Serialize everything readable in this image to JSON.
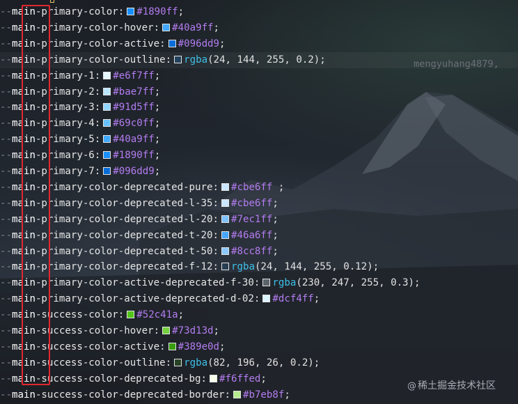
{
  "blame_annotation": "mengyuhang4879,",
  "watermark": {
    "icon": "copyright-icon",
    "icon_glyph": "@",
    "text": "稀土掘金技术社区"
  },
  "lines": [
    {
      "indent": "--",
      "word": "main",
      "name": "-primary-color:",
      "value_type": "hex",
      "value": "#1890ff",
      "swatch": "#1890ff",
      "end": ";"
    },
    {
      "indent": "--",
      "word": "main",
      "name": "-primary-color-hover:",
      "value_type": "hex",
      "value": "#40a9ff",
      "swatch": "#40a9ff",
      "end": ";"
    },
    {
      "indent": "--",
      "word": "main",
      "name": "-primary-color-active:",
      "value_type": "hex",
      "value": "#096dd9",
      "swatch": "#096dd9",
      "end": ";"
    },
    {
      "indent": "--",
      "word": "main",
      "name": "-primary-color-outline:",
      "value_type": "rgba",
      "fn": "rgba",
      "args": "(24, 144, 255, 0.2)",
      "swatch": "rgba(24,144,255,0.2)",
      "end": ";",
      "highlighted": true
    },
    {
      "indent": "--",
      "word": "main",
      "name": "-primary-1:",
      "value_type": "hex",
      "value": "#e6f7ff",
      "swatch": "#e6f7ff",
      "end": ";"
    },
    {
      "indent": "--",
      "word": "main",
      "name": "-primary-2:",
      "value_type": "hex",
      "value": "#bae7ff",
      "swatch": "#bae7ff",
      "end": ";"
    },
    {
      "indent": "--",
      "word": "main",
      "name": "-primary-3:",
      "value_type": "hex",
      "value": "#91d5ff",
      "swatch": "#91d5ff",
      "end": ";"
    },
    {
      "indent": "--",
      "word": "main",
      "name": "-primary-4:",
      "value_type": "hex",
      "value": "#69c0ff",
      "swatch": "#69c0ff",
      "end": ";"
    },
    {
      "indent": "--",
      "word": "main",
      "name": "-primary-5:",
      "value_type": "hex",
      "value": "#40a9ff",
      "swatch": "#40a9ff",
      "end": ";"
    },
    {
      "indent": "--",
      "word": "main",
      "name": "-primary-6:",
      "value_type": "hex",
      "value": "#1890ff",
      "swatch": "#1890ff",
      "end": ";"
    },
    {
      "indent": "--",
      "word": "main",
      "name": "-primary-7:",
      "value_type": "hex",
      "value": "#096dd9",
      "swatch": "#096dd9",
      "end": ";"
    },
    {
      "indent": "--",
      "word": "main",
      "name": "-primary-color-deprecated-pure:",
      "value_type": "hex",
      "value": "#cbe6ff",
      "swatch": "#cbe6ff",
      "end": " ;"
    },
    {
      "indent": "--",
      "word": "main",
      "name": "-primary-color-deprecated-l-35:",
      "value_type": "hex",
      "value": "#cbe6ff",
      "swatch": "#cbe6ff",
      "end": ";"
    },
    {
      "indent": "--",
      "word": "main",
      "name": "-primary-color-deprecated-l-20:",
      "value_type": "hex",
      "value": "#7ec1ff",
      "swatch": "#7ec1ff",
      "end": ";"
    },
    {
      "indent": "--",
      "word": "main",
      "name": "-primary-color-deprecated-t-20:",
      "value_type": "hex",
      "value": "#46a6ff",
      "swatch": "#46a6ff",
      "end": ";"
    },
    {
      "indent": "--",
      "word": "main",
      "name": "-primary-color-deprecated-t-50:",
      "value_type": "hex",
      "value": "#8cc8ff",
      "swatch": "#8cc8ff",
      "end": ";"
    },
    {
      "indent": "--",
      "word": "main",
      "name": "-primary-color-deprecated-f-12:",
      "value_type": "rgba",
      "fn": "rgba",
      "args": "(24, 144, 255, 0.12)",
      "swatch": "rgba(24,144,255,0.12)",
      "end": ";"
    },
    {
      "indent": "--",
      "word": "main",
      "name": "-primary-color-active-deprecated-f-30:",
      "value_type": "rgba",
      "fn": "rgba",
      "args": "(230, 247, 255, 0.3)",
      "swatch": "rgba(230,247,255,0.3)",
      "end": ";"
    },
    {
      "indent": "--",
      "word": "main",
      "name": "-primary-color-active-deprecated-d-02:",
      "value_type": "hex",
      "value": "#dcf4ff",
      "swatch": "#dcf4ff",
      "end": ";"
    },
    {
      "indent": "--",
      "word": "main",
      "name": "-success-color:",
      "value_type": "hex",
      "value": "#52c41a",
      "swatch": "#52c41a",
      "end": ";"
    },
    {
      "indent": "--",
      "word": "main",
      "name": "-success-color-hover:",
      "value_type": "hex",
      "value": "#73d13d",
      "swatch": "#73d13d",
      "end": ";"
    },
    {
      "indent": "--",
      "word": "main",
      "name": "-success-color-active:",
      "value_type": "hex",
      "value": "#389e0d",
      "swatch": "#389e0d",
      "end": ";"
    },
    {
      "indent": "--",
      "word": "main",
      "name": "-success-color-outline:",
      "value_type": "rgba",
      "fn": "rgba",
      "args": "(82, 196, 26, 0.2)",
      "swatch": "rgba(82,196,26,0.2)",
      "end": ";"
    },
    {
      "indent": "--",
      "word": "main",
      "name": "-success-color-deprecated-bg:",
      "value_type": "hex",
      "value": "#f6ffed",
      "swatch": "#f6ffed",
      "end": ";"
    },
    {
      "indent": "--",
      "word": "main",
      "name": "-success-color-deprecated-border:",
      "value_type": "hex",
      "value": "#b7eb8f",
      "swatch": "#b7eb8f",
      "end": ";"
    }
  ]
}
